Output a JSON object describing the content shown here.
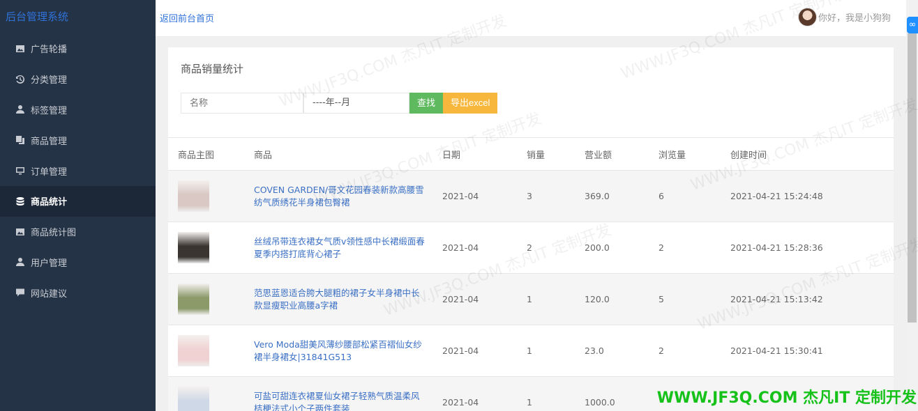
{
  "app": {
    "title": "后台管理系统"
  },
  "sidebar": {
    "items": [
      {
        "label": "广告轮播",
        "icon": "image-icon",
        "active": false
      },
      {
        "label": "分类管理",
        "icon": "history-icon",
        "active": false
      },
      {
        "label": "标签管理",
        "icon": "user-icon",
        "active": false
      },
      {
        "label": "商品管理",
        "icon": "copy-icon",
        "active": false
      },
      {
        "label": "订单管理",
        "icon": "monitor-icon",
        "active": false
      },
      {
        "label": "商品统计",
        "icon": "database-icon",
        "active": true
      },
      {
        "label": "商品统计图",
        "icon": "image-icon",
        "active": false
      },
      {
        "label": "用户管理",
        "icon": "user-icon",
        "active": false
      },
      {
        "label": "网站建议",
        "icon": "comment-icon",
        "active": false
      }
    ]
  },
  "header": {
    "back_link": "返回前台首页",
    "greeting": "你好，我是小狗狗"
  },
  "main": {
    "title": "商品销量统计",
    "filters": {
      "name_placeholder": "名称",
      "month_value": "----年--月",
      "search_label": "查找",
      "export_label": "导出excel"
    },
    "table": {
      "headers": [
        "商品主图",
        "商品",
        "日期",
        "销量",
        "营业额",
        "浏览量",
        "创建时间"
      ],
      "rows": [
        {
          "name": "COVEN GARDEN/哥文花园春装新款高腰雪纺气质绣花半身裙包臀裙",
          "date": "2021-04",
          "sales": "3",
          "revenue": "369.0",
          "views": "6",
          "created": "2021-04-21 15:24:48",
          "thumb_color": "#d9c8c4"
        },
        {
          "name": "丝绒吊带连衣裙女气质v领性感中长裙缎面春夏季内搭打底背心裙子",
          "date": "2021-04",
          "sales": "2",
          "revenue": "200.0",
          "views": "2",
          "created": "2021-04-21 15:28:36",
          "thumb_color": "#3a3530"
        },
        {
          "name": "范思蓝恩适合胯大腿粗的裙子女半身裙中长款显瘦职业高腰a字裙",
          "date": "2021-04",
          "sales": "1",
          "revenue": "120.0",
          "views": "5",
          "created": "2021-04-21 15:13:42",
          "thumb_color": "#8c9a6a"
        },
        {
          "name": "Vero Moda甜美风薄纱腰部松紧百褶仙女纱裙半身裙女|31841G513",
          "date": "2021-04",
          "sales": "1",
          "revenue": "23.0",
          "views": "2",
          "created": "2021-04-21 15:30:41",
          "thumb_color": "#f0d2d2"
        },
        {
          "name": "可盐可甜连衣裙夏仙女裙子轻熟气质温柔风桔梗法式小个子两件套装",
          "date": "2021-04",
          "sales": "1",
          "revenue": "1000.0",
          "views": "",
          "created": "",
          "thumb_color": "#cfd8e6"
        }
      ]
    }
  },
  "watermark": {
    "text": "WWW.JF3Q.COM 杰凡IT  定制开发",
    "banner": "WWW.JF3Q.COM 杰凡IT  定制开发"
  }
}
